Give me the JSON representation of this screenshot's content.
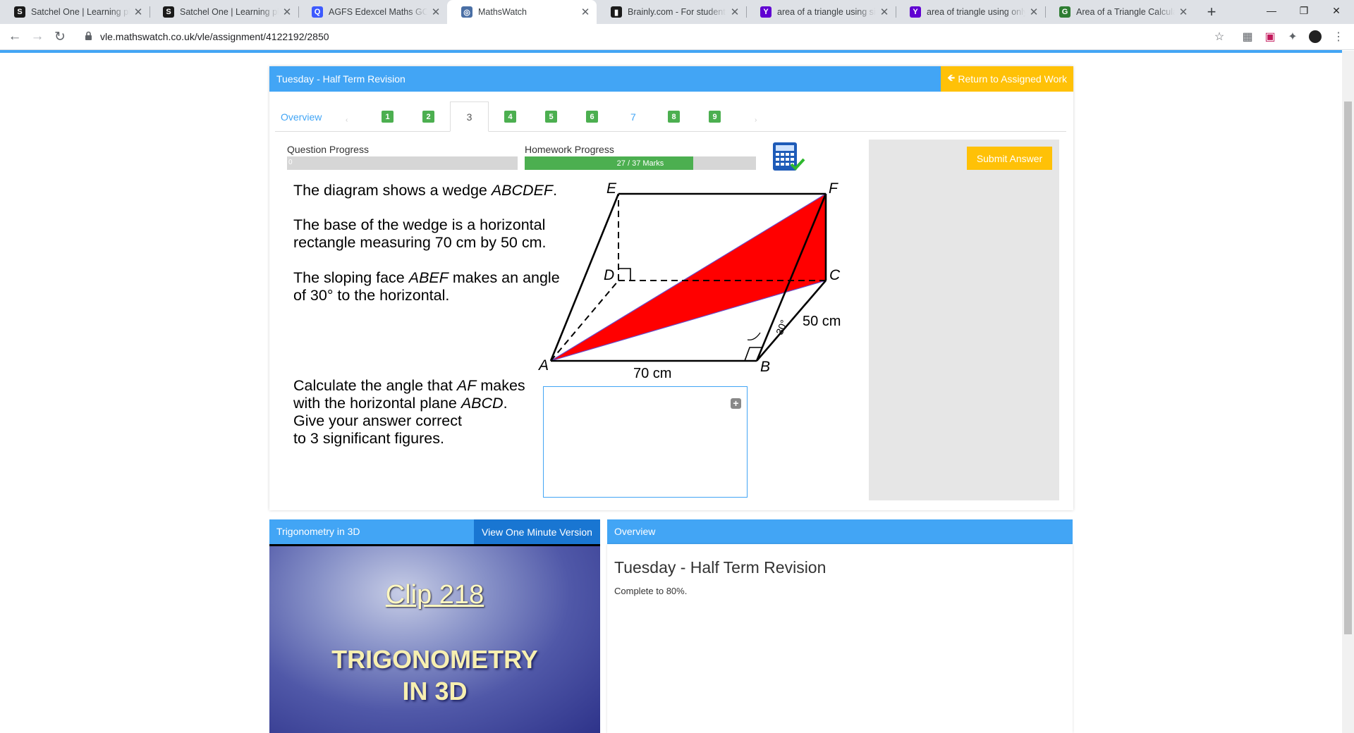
{
  "browser": {
    "tabs": [
      {
        "title": "Satchel One | Learning platf",
        "favicon": "S",
        "color": "#1a1a1a"
      },
      {
        "title": "Satchel One | Learning platf",
        "favicon": "S",
        "color": "#1a1a1a"
      },
      {
        "title": "AGFS Edexcel Maths GCSE F",
        "favicon": "Q",
        "color": "#3d5afe"
      },
      {
        "title": "MathsWatch",
        "favicon": "◎",
        "color": "#4a6fa5"
      },
      {
        "title": "Brainly.com - For students. I",
        "favicon": "▮",
        "color": "#1a1a1a"
      },
      {
        "title": "area of a triangle using sine",
        "favicon": "Y",
        "color": "#6001d2"
      },
      {
        "title": "area of triangle using only a",
        "favicon": "Y",
        "color": "#6001d2"
      },
      {
        "title": "Area of a Triangle Calculato",
        "favicon": "G",
        "color": "#2e7d32"
      }
    ],
    "url": "vle.mathswatch.co.uk/vle/assignment/4122192/2850"
  },
  "assignment": {
    "title": "Tuesday - Half Term Revision",
    "return_label": "Return to Assigned Work"
  },
  "question_tabs": {
    "overview": "Overview",
    "items": [
      "1",
      "2",
      "3",
      "4",
      "5",
      "6",
      "7",
      "8",
      "9"
    ],
    "active": "3"
  },
  "progress": {
    "question_label": "Question Progress",
    "question_value": "0",
    "question_fraction": 0,
    "homework_label": "Homework Progress",
    "homework_value": "27 / 37 Marks",
    "homework_fraction": 0.73
  },
  "question": {
    "intro": [
      "The diagram shows a wedge ",
      "ABCDEF",
      "."
    ],
    "base_line1": "The base of the wedge is a horizontal",
    "base_line2": "rectangle measuring 70 cm by 50 cm.",
    "slope_line1": [
      "The sloping face ",
      "ABEF",
      " makes an angle"
    ],
    "slope_line2": "of 30° to the horizontal.",
    "task_line1": [
      "Calculate the angle that ",
      "AF",
      " makes"
    ],
    "task_line2": [
      "with the horizontal plane ",
      "ABCD",
      "."
    ],
    "task_line3": "Give your answer correct",
    "task_line4": "to 3 significant figures."
  },
  "diagram": {
    "labels": {
      "A": "A",
      "B": "B",
      "C": "C",
      "D": "D",
      "E": "E",
      "F": "F"
    },
    "length_ab": "70 cm",
    "length_bc": "50 cm",
    "angle": "30°",
    "highlight_color": "#ff0000"
  },
  "submit_label": "Submit Answer",
  "video": {
    "title": "Trigonometry in 3D",
    "one_minute_label": "View One Minute Version",
    "clip": "Clip 218",
    "clip_title_line1": "TRIGONOMETRY",
    "clip_title_line2": "IN 3D"
  },
  "overview": {
    "header": "Overview",
    "name": "Tuesday - Half Term Revision",
    "desc": "Complete to 80%."
  },
  "colors": {
    "primary": "#42a5f5",
    "accent": "#ffc107",
    "success": "#4caf50"
  }
}
